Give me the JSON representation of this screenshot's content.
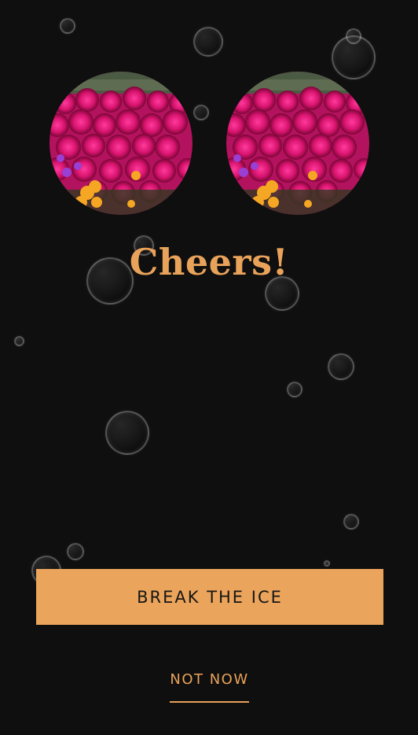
{
  "match": {
    "title": "Cheers!",
    "left_photo": "flower-garden-photo",
    "right_photo": "flower-garden-photo"
  },
  "actions": {
    "primary_label": "BREAK THE ICE",
    "secondary_label": "NOT NOW"
  },
  "colors": {
    "background": "#0f0f0f",
    "accent": "#eba45b",
    "button_text": "#161616"
  }
}
